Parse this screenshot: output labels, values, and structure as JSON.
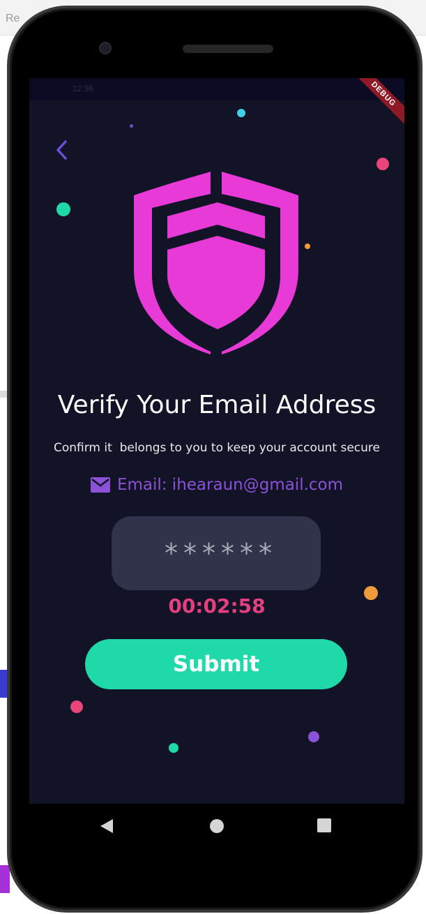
{
  "host": {
    "window_title": "Re"
  },
  "status_bar": {
    "time": "12:36",
    "debug_banner": "DEBUG"
  },
  "header": {
    "back_icon": "chevron-left-icon"
  },
  "hero": {
    "icon": "shield-icon"
  },
  "title": "Verify Your Email Address",
  "subtitle": "Confirm it  belongs to you to keep your account secure",
  "email": {
    "icon": "mail-icon",
    "text": "Email: ihearaun@gmail.com"
  },
  "code_input": {
    "value": "******"
  },
  "timer": "00:02:58",
  "submit_label": "Submit",
  "nav": {
    "back_icon": "triangle-back-icon",
    "home_icon": "circle-home-icon",
    "recents_icon": "square-recents-icon"
  },
  "colors": {
    "background": "#121326",
    "accent_pink": "#e83ad6",
    "accent_purple": "#8a52d6",
    "timer": "#e43f7f",
    "submit": "#1fd9a8",
    "input_bg": "#30334a"
  }
}
